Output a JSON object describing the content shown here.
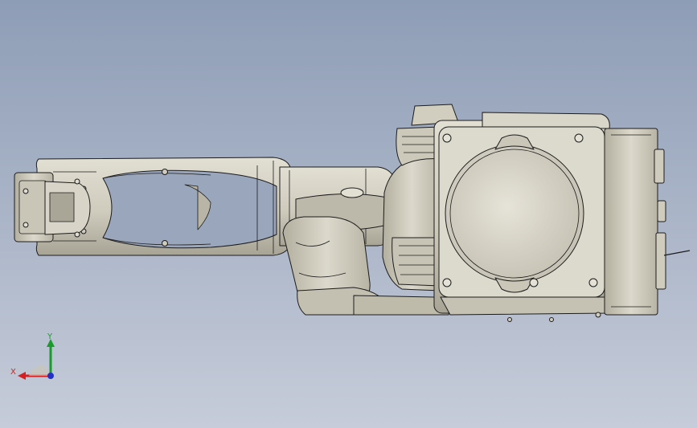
{
  "viewport": {
    "background_top": "#8e9db6",
    "background_bottom": "#c6ccd9"
  },
  "model": {
    "body_color": "#d6d2c4",
    "shade_color": "#a9a596",
    "edge_color": "#1c1c1c"
  },
  "triad": {
    "x_label": "X",
    "y_label": "Y",
    "x_color": "#d42020",
    "y_color": "#1a9a2a",
    "z_color": "#2030c8"
  }
}
